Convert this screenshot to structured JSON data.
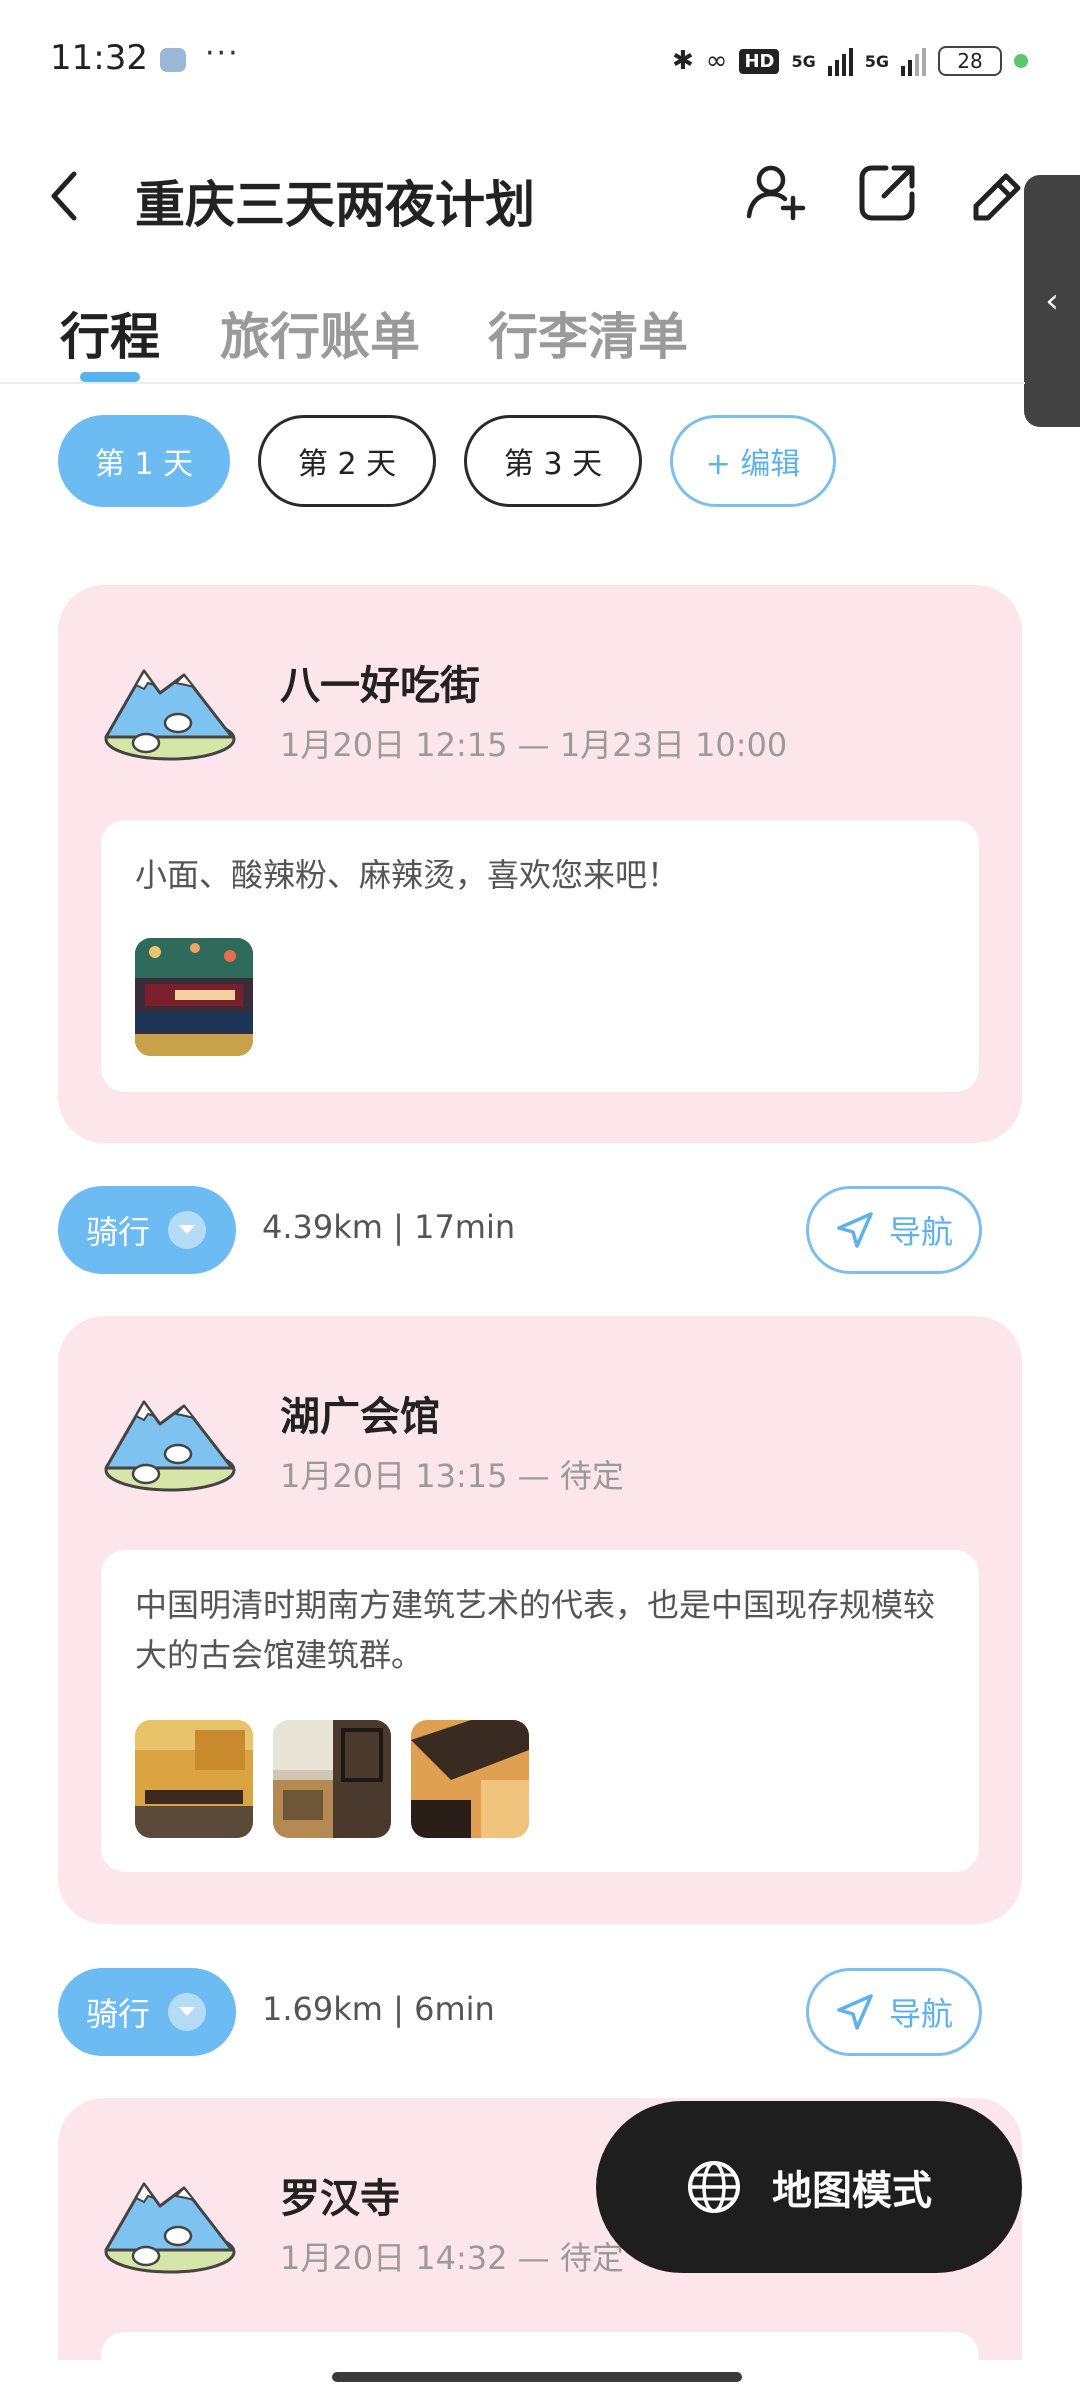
{
  "status_bar": {
    "time": "11:32",
    "more": "···",
    "hd": "HD",
    "sig1": "5G",
    "sig2": "5G",
    "battery": "28"
  },
  "header": {
    "title": "重庆三天两夜计划"
  },
  "tabs": [
    {
      "label": "行程"
    },
    {
      "label": "旅行账单"
    },
    {
      "label": "行李清单"
    }
  ],
  "days": [
    {
      "label": "第 1 天"
    },
    {
      "label": "第 2 天"
    },
    {
      "label": "第 3 天"
    }
  ],
  "edit_label": "+ 编辑",
  "stops": [
    {
      "name": "八一好吃街",
      "time": "1月20日 12:15 — 1月23日 10:00",
      "desc": "小面、酸辣粉、麻辣烫，喜欢您来吧！"
    },
    {
      "name": "湖广会馆",
      "time": "1月20日 13:15 — 待定",
      "desc": "中国明清时期南方建筑艺术的代表，也是中国现存规模较大的古会馆建筑群。"
    },
    {
      "name": "罗汉寺",
      "time": "1月20日 14:32 — 待定"
    }
  ],
  "legs": [
    {
      "mode": "骑行",
      "distance": "4.39km",
      "duration": "17min",
      "nav": "导航"
    },
    {
      "mode": "骑行",
      "distance": "1.69km",
      "duration": "6min",
      "nav": "导航"
    }
  ],
  "map_button": "地图模式",
  "colors": {
    "accent": "#6cbbf2",
    "card_bg": "#fce6ec",
    "fab_bg": "#1e1e1e"
  }
}
